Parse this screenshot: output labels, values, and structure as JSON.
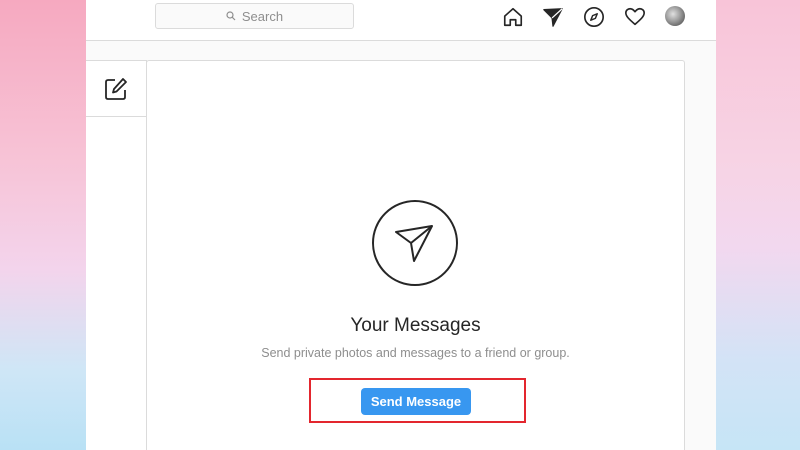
{
  "search": {
    "placeholder": "Search"
  },
  "nav": {
    "icons": [
      "home-icon",
      "direct-icon",
      "explore-icon",
      "heart-icon",
      "avatar"
    ]
  },
  "inbox": {
    "title": "Your Messages",
    "subtitle": "Send private photos and messages to a friend or group.",
    "send_button_label": "Send Message"
  },
  "colors": {
    "accent": "#3897f0",
    "highlight_border": "#e3262e",
    "text_primary": "#262626",
    "text_secondary": "#8e8e8e",
    "border": "#dbdbdb"
  }
}
